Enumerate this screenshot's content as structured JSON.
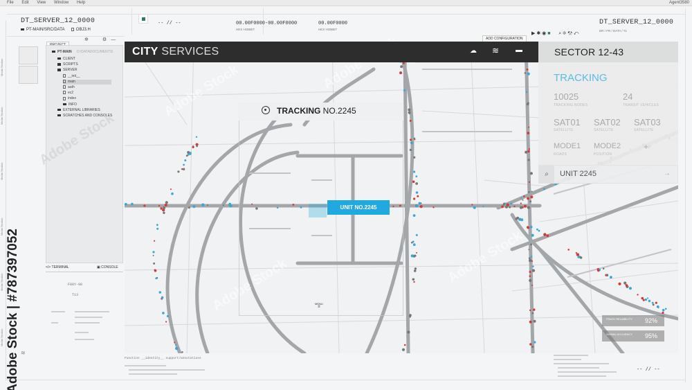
{
  "menubar": {
    "items": [
      "File",
      "Edit",
      "View",
      "Window",
      "Help"
    ],
    "app_name": "Agent3580"
  },
  "left_panel": {
    "server_title": "DT_SERVER_12_0000",
    "path": "PT-MAIN/SRC/DATA",
    "file": "OBJ3.H",
    "project_label": "PROJECT",
    "tree": {
      "root": "PT-MAIN",
      "root_hash": "D:\\DATADOCUMENTS\\",
      "items": [
        {
          "label": "CLIENT",
          "kind": "folder",
          "indent": 1
        },
        {
          "label": "SCRIPTS",
          "kind": "folder",
          "indent": 1
        },
        {
          "label": "SERVER",
          "kind": "folder",
          "indent": 1
        },
        {
          "label": "__init__",
          "kind": "file",
          "indent": 2
        },
        {
          "label": "main",
          "kind": "file",
          "indent": 2
        },
        {
          "label": "auth",
          "kind": "file",
          "indent": 2
        },
        {
          "label": "ec2",
          "kind": "file",
          "indent": 2
        },
        {
          "label": "index",
          "kind": "file",
          "indent": 2
        },
        {
          "label": "INFO",
          "kind": "folder",
          "indent": 2
        },
        {
          "label": "EXTERNAL LIBRARIES",
          "kind": "folder",
          "indent": 1
        },
        {
          "label": "SCRATCHES AND CONSOLES",
          "kind": "folder",
          "indent": 1
        }
      ]
    },
    "terminal_label": "TERMINAL",
    "console_label": "CONSOLE",
    "code_sample": "F88Y-08",
    "code_value": "T13"
  },
  "top_strip": {
    "slash_text": "-- // --",
    "hex_a": "00.00F0000-00.00F0000",
    "hex_b": "00.00F0000",
    "label_a": "HEX HOBBIT",
    "label_b": "HEX HOBBIT",
    "add_config": "ADD CONFIGURATION"
  },
  "right_panel": {
    "server_title": "DT_SERVER_12_0000",
    "sub": "DR / FR / DATA / T1"
  },
  "city": {
    "title_bold": "CITY",
    "title_light": "SERVICES",
    "icons": [
      "weather-icon",
      "wifi-icon",
      "chat-icon"
    ]
  },
  "sector": {
    "title": "SECTOR 12-43",
    "tracking_label": "TRACKING",
    "stats": [
      {
        "value": "10025",
        "label": "TRACKING NODES"
      },
      {
        "value": "24",
        "label": "TRANSIT VEHICLES"
      }
    ],
    "sats": [
      {
        "value": "SAT01",
        "label": "SATELLITE"
      },
      {
        "value": "SAT02",
        "label": "SATELLITE"
      },
      {
        "value": "SAT03",
        "label": "SATELLITE"
      }
    ],
    "modes": [
      {
        "value": "MODE1",
        "label": "ROADS"
      },
      {
        "value": "MODE2",
        "label": "POSITION"
      }
    ],
    "plus": "+"
  },
  "unit_search": {
    "value": "UNIT 2245",
    "arrow": "→"
  },
  "tracking_card": {
    "bold": "TRACKING",
    "number": "NO.2245",
    "menu": "MENU"
  },
  "unit_tag": "UNIT NO.2245",
  "reliability": [
    {
      "label": "TRACK RELIABILITY",
      "value": "92%"
    },
    {
      "label": "SIGNAL ACCURACY",
      "value": "95%"
    }
  ],
  "watermark": "Adobe Stock",
  "stock_id": "Adobe Stock | #787397052",
  "bottom": {
    "left_text": "Function __identity__ support/annotations",
    "right_slash": "-- // --"
  }
}
